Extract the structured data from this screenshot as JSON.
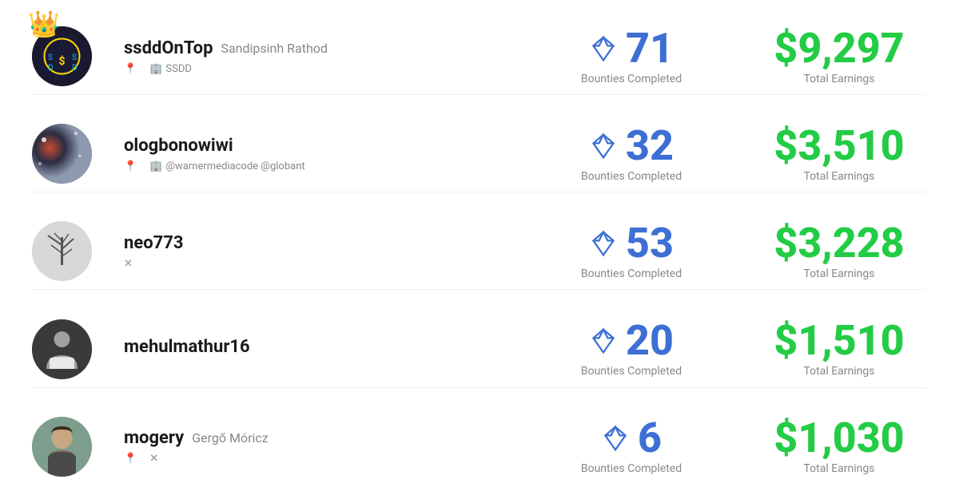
{
  "users": [
    {
      "id": 1,
      "username": "ssddOnTop",
      "real_name": "Sandipsinh Rathod",
      "has_crown": true,
      "avatar_type": "dark_crypto",
      "meta": [
        {
          "icon": "location",
          "text": ""
        },
        {
          "icon": "building",
          "text": "SSDD"
        }
      ],
      "bounties": 71,
      "earnings": "$9,297"
    },
    {
      "id": 2,
      "username": "ologbonowiwi",
      "real_name": "",
      "has_crown": false,
      "avatar_type": "space",
      "meta": [
        {
          "icon": "location",
          "text": ""
        },
        {
          "icon": "building",
          "text": "@warnermediacode @globant"
        }
      ],
      "bounties": 32,
      "earnings": "$3,510"
    },
    {
      "id": 3,
      "username": "neo773",
      "real_name": "",
      "has_crown": false,
      "avatar_type": "tree",
      "meta": [
        {
          "icon": "twitter",
          "text": ""
        }
      ],
      "bounties": 53,
      "earnings": "$3,228"
    },
    {
      "id": 4,
      "username": "mehulmathur16",
      "real_name": "",
      "has_crown": false,
      "avatar_type": "person_dark",
      "meta": [],
      "bounties": 20,
      "earnings": "$1,510"
    },
    {
      "id": 5,
      "username": "mogery",
      "real_name": "Gergő Móricz",
      "has_crown": false,
      "avatar_type": "person_light",
      "meta": [
        {
          "icon": "location",
          "text": ""
        },
        {
          "icon": "twitter",
          "text": ""
        }
      ],
      "bounties": 6,
      "earnings": "$1,030"
    }
  ],
  "labels": {
    "bounties_completed": "Bounties Completed",
    "total_earnings": "Total Earnings"
  }
}
